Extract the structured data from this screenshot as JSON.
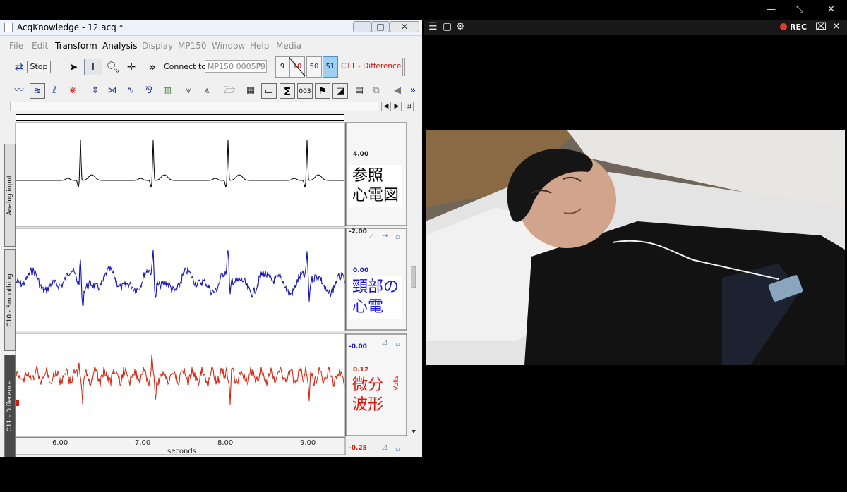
{
  "system_buttons": {
    "minimize": "—",
    "restore": "⤡",
    "close": "✕"
  },
  "acq": {
    "title": "AcqKnowledge - 12.acq *",
    "window_buttons": {
      "minimize": "—",
      "maximize": "□",
      "close": "✕"
    },
    "menu": [
      {
        "label": "File",
        "enabled": false
      },
      {
        "label": "Edit",
        "enabled": false
      },
      {
        "label": "Transform",
        "enabled": true
      },
      {
        "label": "Analysis",
        "enabled": true
      },
      {
        "label": "Display",
        "enabled": false
      },
      {
        "label": "MP150",
        "enabled": false
      },
      {
        "label": "Window",
        "enabled": false
      },
      {
        "label": "Help",
        "enabled": false
      },
      {
        "label": "Media",
        "enabled": false
      }
    ],
    "toolbar": {
      "stop_label": "Stop",
      "more": "»",
      "connect_label": "Connect to:",
      "connect_value": "MP150 0005F9",
      "channels": [
        "9",
        "10",
        "50",
        "51"
      ],
      "channel_label": "C11 - Difference"
    },
    "channels": [
      {
        "name": "Analog input",
        "color": "#000000",
        "top_value": "4.00",
        "bottom_value": "-2.00",
        "note": "参照\n心電図",
        "note_color": "#000000"
      },
      {
        "name": "C10 - Smoothing",
        "color": "#1414b4",
        "top_value": "0.00",
        "bottom_value": "-0.00",
        "note": "頸部の\n心電",
        "note_color": "#1a1ac8"
      },
      {
        "name": "C11 - Difference",
        "color": "#d21e0a",
        "top_value": "0.12",
        "bottom_value": "-0.25",
        "unit": "Volts",
        "note": "微分\n波形",
        "note_color": "#e0140a"
      }
    ],
    "x_axis": {
      "ticks": [
        "6.00",
        "7.00",
        "8.00",
        "9.00"
      ],
      "label": "seconds"
    }
  },
  "camera": {
    "rec_label": "REC"
  },
  "colors": {
    "rec_dot": "#e23a2c",
    "ecg": "#000000",
    "smoothing": "#1414b4",
    "difference": "#d21e0a"
  }
}
